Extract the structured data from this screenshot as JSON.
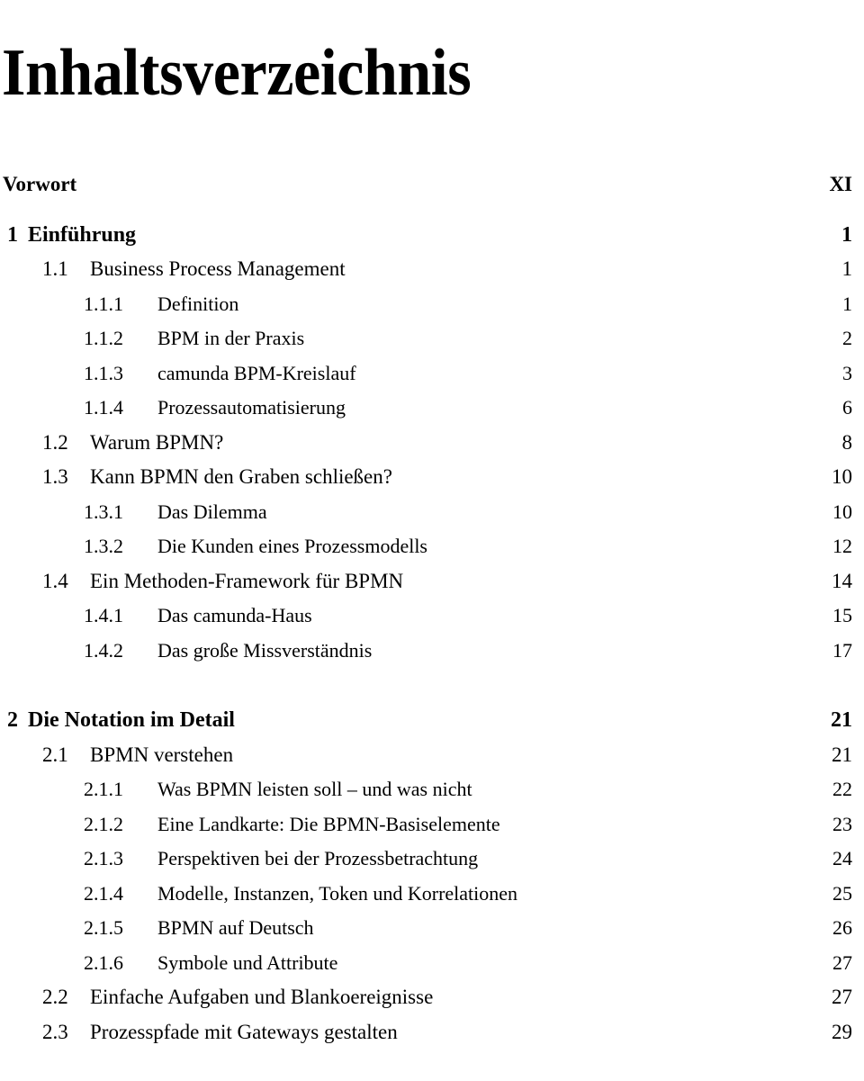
{
  "document": {
    "title": "Inhaltsverzeichnis",
    "text_color": "#000000",
    "background_color": "#ffffff"
  },
  "toc": {
    "entries": [
      {
        "level": 0,
        "number": "",
        "label": "Vorwort",
        "page": "XI",
        "gap": "none"
      },
      {
        "level": 1,
        "number": "1",
        "label": "Einführung",
        "page": "1",
        "gap": "small"
      },
      {
        "level": 2,
        "number": "1.1",
        "label": "Business Process Management",
        "page": "1",
        "gap": "none"
      },
      {
        "level": 3,
        "number": "1.1.1",
        "label": "Definition",
        "page": "1",
        "gap": "none"
      },
      {
        "level": 3,
        "number": "1.1.2",
        "label": "BPM in der Praxis",
        "page": "2",
        "gap": "none"
      },
      {
        "level": 3,
        "number": "1.1.3",
        "label": "camunda BPM-Kreislauf",
        "page": "3",
        "gap": "none"
      },
      {
        "level": 3,
        "number": "1.1.4",
        "label": "Prozessautomatisierung",
        "page": "6",
        "gap": "none"
      },
      {
        "level": 2,
        "number": "1.2",
        "label": "Warum BPMN?",
        "page": "8",
        "gap": "none"
      },
      {
        "level": 2,
        "number": "1.3",
        "label": "Kann BPMN den Graben schließen?",
        "page": "10",
        "gap": "none"
      },
      {
        "level": 3,
        "number": "1.3.1",
        "label": "Das Dilemma",
        "page": "10",
        "gap": "none"
      },
      {
        "level": 3,
        "number": "1.3.2",
        "label": "Die Kunden eines Prozessmodells",
        "page": "12",
        "gap": "none"
      },
      {
        "level": 2,
        "number": "1.4",
        "label": "Ein Methoden-Framework für BPMN",
        "page": "14",
        "gap": "none"
      },
      {
        "level": 3,
        "number": "1.4.1",
        "label": "Das camunda-Haus",
        "page": "15",
        "gap": "none"
      },
      {
        "level": 3,
        "number": "1.4.2",
        "label": "Das große Missverständnis",
        "page": "17",
        "gap": "none"
      },
      {
        "level": 1,
        "number": "2",
        "label": "Die Notation im Detail",
        "page": "21",
        "gap": "chapter"
      },
      {
        "level": 2,
        "number": "2.1",
        "label": "BPMN verstehen",
        "page": "21",
        "gap": "none"
      },
      {
        "level": 3,
        "number": "2.1.1",
        "label": "Was BPMN leisten soll – und was nicht",
        "page": "22",
        "gap": "none"
      },
      {
        "level": 3,
        "number": "2.1.2",
        "label": "Eine Landkarte: Die BPMN-Basiselemente",
        "page": "23",
        "gap": "none"
      },
      {
        "level": 3,
        "number": "2.1.3",
        "label": "Perspektiven bei der Prozessbetrachtung",
        "page": "24",
        "gap": "none"
      },
      {
        "level": 3,
        "number": "2.1.4",
        "label": "Modelle, Instanzen, Token und Korrelationen",
        "page": "25",
        "gap": "none"
      },
      {
        "level": 3,
        "number": "2.1.5",
        "label": "BPMN auf Deutsch",
        "page": "26",
        "gap": "none"
      },
      {
        "level": 3,
        "number": "2.1.6",
        "label": "Symbole und Attribute",
        "page": "27",
        "gap": "none"
      },
      {
        "level": 2,
        "number": "2.2",
        "label": "Einfache Aufgaben und Blankoereignisse",
        "page": "27",
        "gap": "none"
      },
      {
        "level": 2,
        "number": "2.3",
        "label": "Prozesspfade mit Gateways gestalten",
        "page": "29",
        "gap": "none"
      }
    ]
  }
}
